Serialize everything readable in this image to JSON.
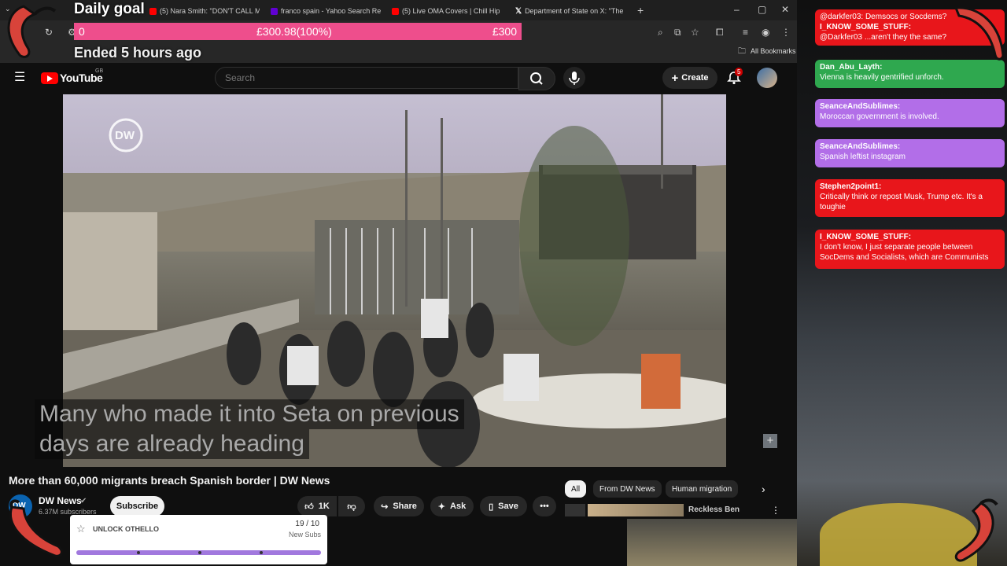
{
  "browser": {
    "tabs": [
      {
        "label": "(5) Nara Smith: \"DON'T CALL M",
        "color": "#ff0000"
      },
      {
        "label": "franco spain - Yahoo Search Re",
        "color": "#6001d2"
      },
      {
        "label": "(5) Live OMA Covers | Chill Hip",
        "color": "#ff0000"
      },
      {
        "label": "Department of State on X: \"The",
        "color": "#ffffff"
      }
    ],
    "bookmarks_label": "All Bookmarks"
  },
  "goal": {
    "title": "Daily goal",
    "current": "0",
    "amount": "£300.98(100%)",
    "target": "£300",
    "status": "Ended 5 hours ago",
    "progress": 1.0
  },
  "youtube": {
    "region": "GB",
    "search_placeholder": "Search",
    "create_label": "Create",
    "notification_count": "5"
  },
  "video": {
    "watermark": "DW",
    "subtitle_line1": "Many who made it into Seta on previous",
    "subtitle_line2": "days are already heading",
    "title": "More than 60,000 migrants breach Spanish border | DW News",
    "channel": "DW News",
    "subscribers": "6.37M subscribers",
    "subscribe_label": "Subscribe",
    "likes": "1K",
    "share_label": "Share",
    "ask_label": "Ask",
    "save_label": "Save"
  },
  "chips": [
    "All",
    "From DW News",
    "Human migration"
  ],
  "recommendation": {
    "channel": "Reckless Ben"
  },
  "chat": [
    {
      "user": "",
      "text": "@darkfer03: Demsocs or Socdems?",
      "color": "#e8161b"
    },
    {
      "user": "I_KNOW_SOME_STUFF:",
      "text": "@Darkfer03 ...aren't they the same?",
      "color": "#e8161b"
    },
    {
      "user": "Dan_Abu_Layth:",
      "text": "Vienna is heavily gentrified unforch.",
      "color": "#2fa84f"
    },
    {
      "user": "SeanceAndSublimes:",
      "text": "Moroccan government is involved.",
      "color": "#b26ee8"
    },
    {
      "user": "SeanceAndSublimes:",
      "text": "Spanish leftist instagram",
      "color": "#b26ee8"
    },
    {
      "user": "Stephen2point1:",
      "text": "Critically think or repost Musk, Trump etc. It's a toughie",
      "color": "#e8161b"
    },
    {
      "user": "I_KNOW_SOME_STUFF:",
      "text": "I don't know, I just separate people between SocDems and Socialists, which are Communists",
      "color": "#e8161b"
    }
  ],
  "sub_goal": {
    "label": "UNLOCK OTHELLO",
    "count": "19 / 10",
    "caption": "New Subs",
    "progress": 1.0
  }
}
